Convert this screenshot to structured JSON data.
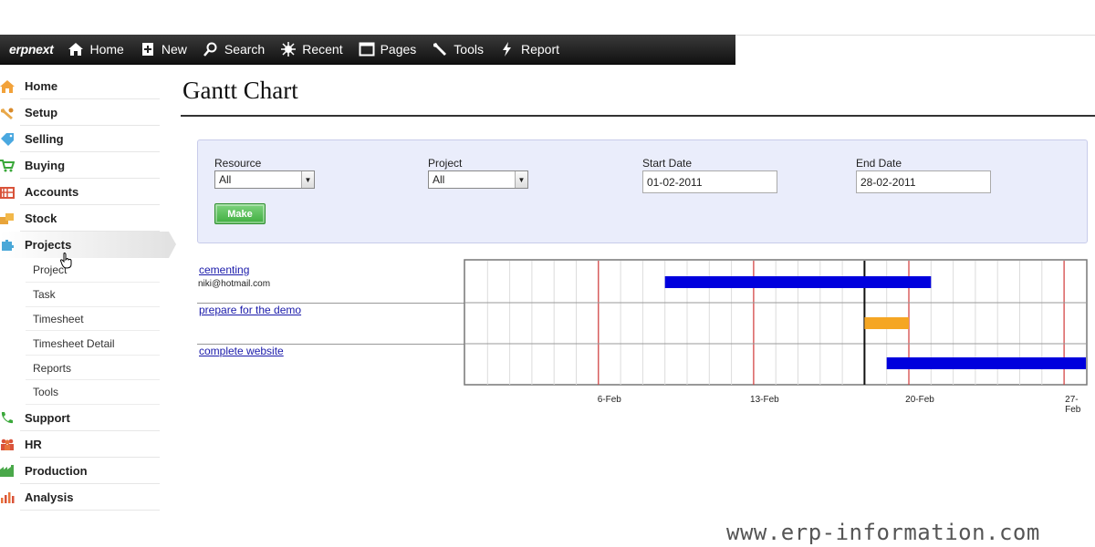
{
  "navbar": {
    "brand": "erpnext",
    "items": [
      {
        "label": "Home",
        "icon": "home-icon"
      },
      {
        "label": "New",
        "icon": "new-doc-icon"
      },
      {
        "label": "Search",
        "icon": "search-icon"
      },
      {
        "label": "Recent",
        "icon": "recent-icon"
      },
      {
        "label": "Pages",
        "icon": "pages-icon"
      },
      {
        "label": "Tools",
        "icon": "wrench-icon"
      },
      {
        "label": "Report",
        "icon": "bolt-icon"
      }
    ]
  },
  "sidebar": {
    "items": [
      {
        "label": "Home",
        "icon": "home-icon",
        "color": "#f2a23a"
      },
      {
        "label": "Setup",
        "icon": "setup-icon",
        "color": "#e8a84a"
      },
      {
        "label": "Selling",
        "icon": "tag-icon",
        "color": "#4aa8e0"
      },
      {
        "label": "Buying",
        "icon": "cart-icon",
        "color": "#3aa83a"
      },
      {
        "label": "Accounts",
        "icon": "ledger-icon",
        "color": "#d9533a"
      },
      {
        "label": "Stock",
        "icon": "boxes-icon",
        "color": "#e8a43a"
      },
      {
        "label": "Projects",
        "icon": "puzzle-icon",
        "color": "#4aa8d8"
      }
    ],
    "sub_items": [
      "Project",
      "Task",
      "Timesheet",
      "Timesheet Detail",
      "Reports",
      "Tools"
    ],
    "bottom_items": [
      {
        "label": "Support",
        "icon": "phone-icon",
        "color": "#3aa83a"
      },
      {
        "label": "HR",
        "icon": "people-icon",
        "color": "#d9533a"
      },
      {
        "label": "Production",
        "icon": "factory-icon",
        "color": "#4aa84a"
      },
      {
        "label": "Analysis",
        "icon": "bar-chart-icon",
        "color": "#e8733a"
      }
    ]
  },
  "page": {
    "title": "Gantt Chart"
  },
  "filters": {
    "resource_label": "Resource",
    "resource_value": "All",
    "project_label": "Project",
    "project_value": "All",
    "start_label": "Start Date",
    "start_value": "01-02-2011",
    "end_label": "End Date",
    "end_value": "28-02-2011",
    "make_label": "Make"
  },
  "gantt": {
    "tasks": [
      {
        "name": "cementing",
        "owner": "niki@hotmail.com",
        "start": "2011-02-09",
        "end": "2011-02-21",
        "color": "#0000dd"
      },
      {
        "name": "prepare for the demo",
        "owner": "",
        "start": "2011-02-18",
        "end": "2011-02-20",
        "color": "#f5a623"
      },
      {
        "name": "complete website",
        "owner": "",
        "start": "2011-02-19",
        "end": "2011-02-28",
        "color": "#0000dd"
      }
    ],
    "ticks": [
      "6-Feb",
      "13-Feb",
      "20-Feb",
      "27-Feb"
    ],
    "today": "2011-02-18"
  },
  "watermark": "www.erp-information.com"
}
